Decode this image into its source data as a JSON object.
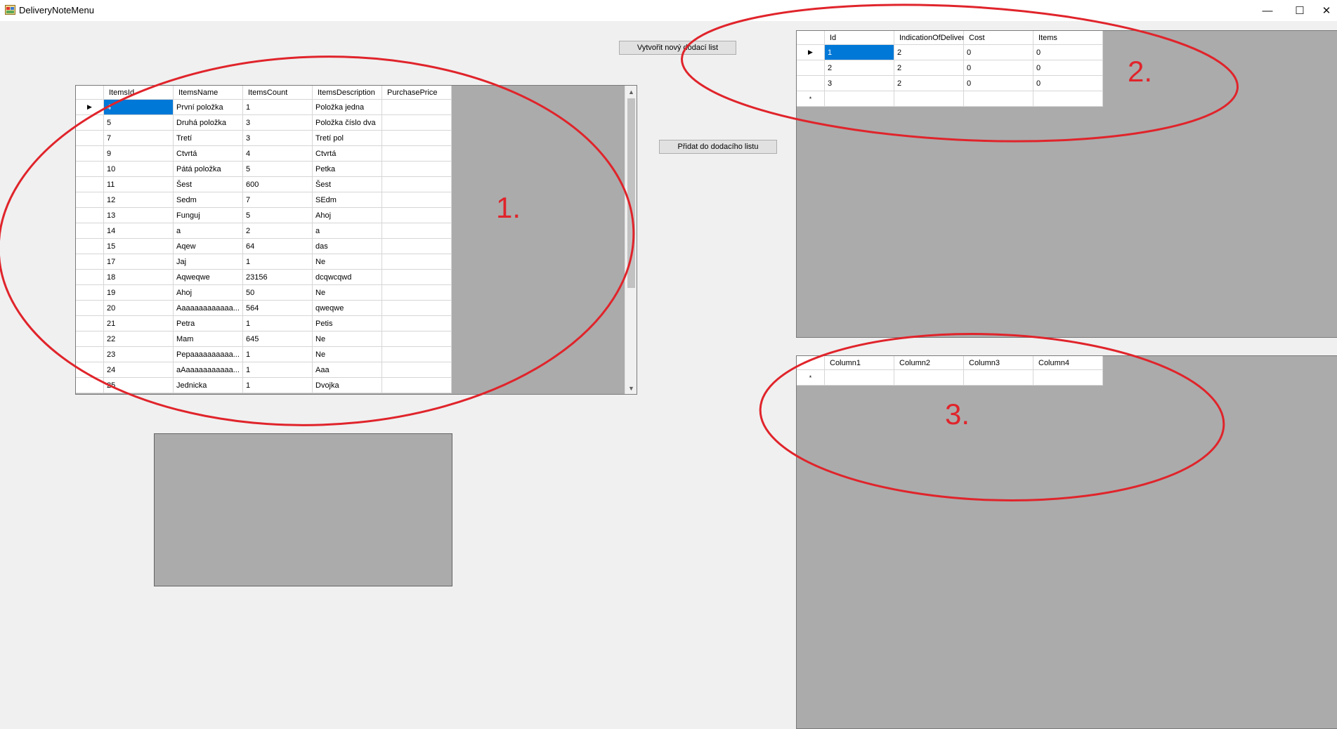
{
  "window": {
    "title": "DeliveryNoteMenu",
    "minimize": "—",
    "maximize": "☐",
    "close": "✕"
  },
  "buttons": {
    "create_note": "Vytvořit nový dodací list",
    "add_to_note": "Přidat do dodacího listu"
  },
  "items_grid": {
    "columns": [
      "ItemsId",
      "ItemsName",
      "ItemsCount",
      "ItemsDescription",
      "PurchasePrice"
    ],
    "rows": [
      [
        "4",
        "První položka",
        "1",
        "Položka jedna",
        ""
      ],
      [
        "5",
        "Druhá položka",
        "3",
        "Položka číslo dva",
        ""
      ],
      [
        "7",
        "Tretí",
        "3",
        "Tretí pol",
        ""
      ],
      [
        "9",
        "Ctvrtá",
        "4",
        "Ctvrtá",
        ""
      ],
      [
        "10",
        "Pátá položka",
        "5",
        "Petka",
        ""
      ],
      [
        "11",
        "Šest",
        "600",
        "Šest",
        ""
      ],
      [
        "12",
        "Sedm",
        "7",
        "SEdm",
        ""
      ],
      [
        "13",
        "Funguj",
        "5",
        "Ahoj",
        ""
      ],
      [
        "14",
        "a",
        "2",
        "a",
        ""
      ],
      [
        "15",
        "Aqew",
        "64",
        "das",
        ""
      ],
      [
        "17",
        "Jaj",
        "1",
        "Ne",
        ""
      ],
      [
        "18",
        "Aqweqwe",
        "23156",
        "dcqwcqwd",
        ""
      ],
      [
        "19",
        "Ahoj",
        "50",
        "Ne",
        ""
      ],
      [
        "20",
        "Aaaaaaaaaaaaa...",
        "564",
        "qweqwe",
        ""
      ],
      [
        "21",
        "Petra",
        "1",
        "Petis",
        ""
      ],
      [
        "22",
        "Mam",
        "645",
        "Ne",
        ""
      ],
      [
        "23",
        "Pepaaaaaaaaaa...",
        "1",
        "Ne",
        ""
      ],
      [
        "24",
        "aAaaaaaaaaaaa...",
        "1",
        "Aaa",
        ""
      ],
      [
        "25",
        "Jednicka",
        "1",
        "Dvojka",
        ""
      ]
    ]
  },
  "notes_grid": {
    "columns": [
      "Id",
      "IndicationOfDelivery",
      "Cost",
      "Items"
    ],
    "rows": [
      [
        "1",
        "2",
        "0",
        "0"
      ],
      [
        "2",
        "2",
        "0",
        "0"
      ],
      [
        "3",
        "2",
        "0",
        "0"
      ]
    ]
  },
  "detail_grid": {
    "columns": [
      "Column1",
      "Column2",
      "Column3",
      "Column4"
    ]
  },
  "annotations": [
    "1.",
    "2.",
    "3."
  ],
  "colors": {
    "annotation": "#e0242b",
    "selection": "#0078d7",
    "grid_background": "#ababab"
  }
}
